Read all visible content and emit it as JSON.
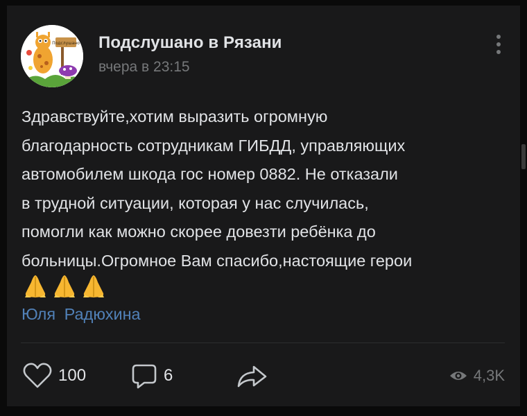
{
  "post": {
    "group_name": "Подслушано в Рязани",
    "time": "вчера в 23:15",
    "avatar_text": "Подслушано",
    "text_lines": [
      "Здравствуйте,хотим выразить огромную",
      "благодарность сотрудникам ГИБДД, управляющих",
      "автомобилем шкода гос номер 0882. Не отказали",
      "в трудной ситуации, которая у нас случилась,",
      "помогли как можно скорее довезти ребёнка до",
      "больницы.Огромное Вам спасибо,настоящие герои"
    ],
    "emoji": [
      "🙏",
      "🙏",
      "🙏"
    ],
    "author_link": "Юля  Радюхина"
  },
  "actions": {
    "likes": "100",
    "comments": "6",
    "views": "4,3K"
  },
  "colors": {
    "background": "#0a0a0a",
    "card": "#19191a",
    "text": "#e1e3e6",
    "secondary": "#76787a",
    "link": "#5181b8"
  }
}
